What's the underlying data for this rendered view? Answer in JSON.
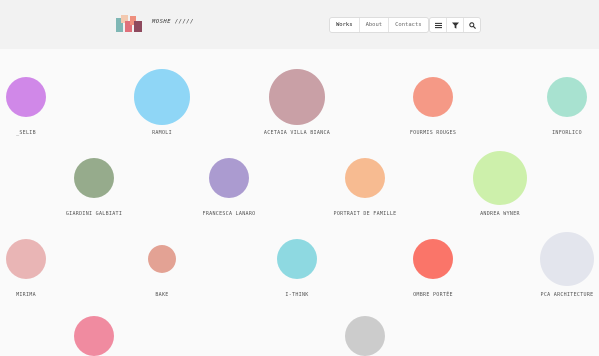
{
  "header": {
    "brand": "MOSHE /////",
    "nav": [
      {
        "label": "Works",
        "active": true
      },
      {
        "label": "About",
        "active": false
      },
      {
        "label": "Contacts",
        "active": false
      }
    ],
    "tools": [
      {
        "icon": "list-icon"
      },
      {
        "icon": "filter-icon"
      },
      {
        "icon": "search-icon"
      }
    ]
  },
  "works": [
    {
      "title": "_SELIB",
      "color": "#d088e8"
    },
    {
      "title": "RAMOLI",
      "color": "#8fd6f6"
    },
    {
      "title": "ACETAIA VILLA BIANCA",
      "color": "#c9a0a6"
    },
    {
      "title": "FOURMIS ROUGES",
      "color": "#f59986"
    },
    {
      "title": "INFORLICO",
      "color": "#a8e2d0"
    },
    {
      "title": "GIARDINI GALBIATI",
      "color": "#96ab8c"
    },
    {
      "title": "FRANCESCA LANARO",
      "color": "#ab9bd0"
    },
    {
      "title": "PORTRAIT DE FAMILLE",
      "color": "#f7bb91"
    },
    {
      "title": "ANDREA WYNER",
      "color": "#cdf0ab"
    },
    {
      "title": "MIRIMA",
      "color": "#e9b5b5"
    },
    {
      "title": "BAKE",
      "color": "#e3a294"
    },
    {
      "title": "I-THINK",
      "color": "#8ed9e1"
    },
    {
      "title": "OMBRE PORTÉE",
      "color": "#fa7569"
    },
    {
      "title": "PCA ARCHITECTURE",
      "color": "#e3e5ed"
    },
    {
      "title": "",
      "color": "#f08ba0"
    },
    {
      "title": "",
      "color": "#cccccc"
    }
  ]
}
